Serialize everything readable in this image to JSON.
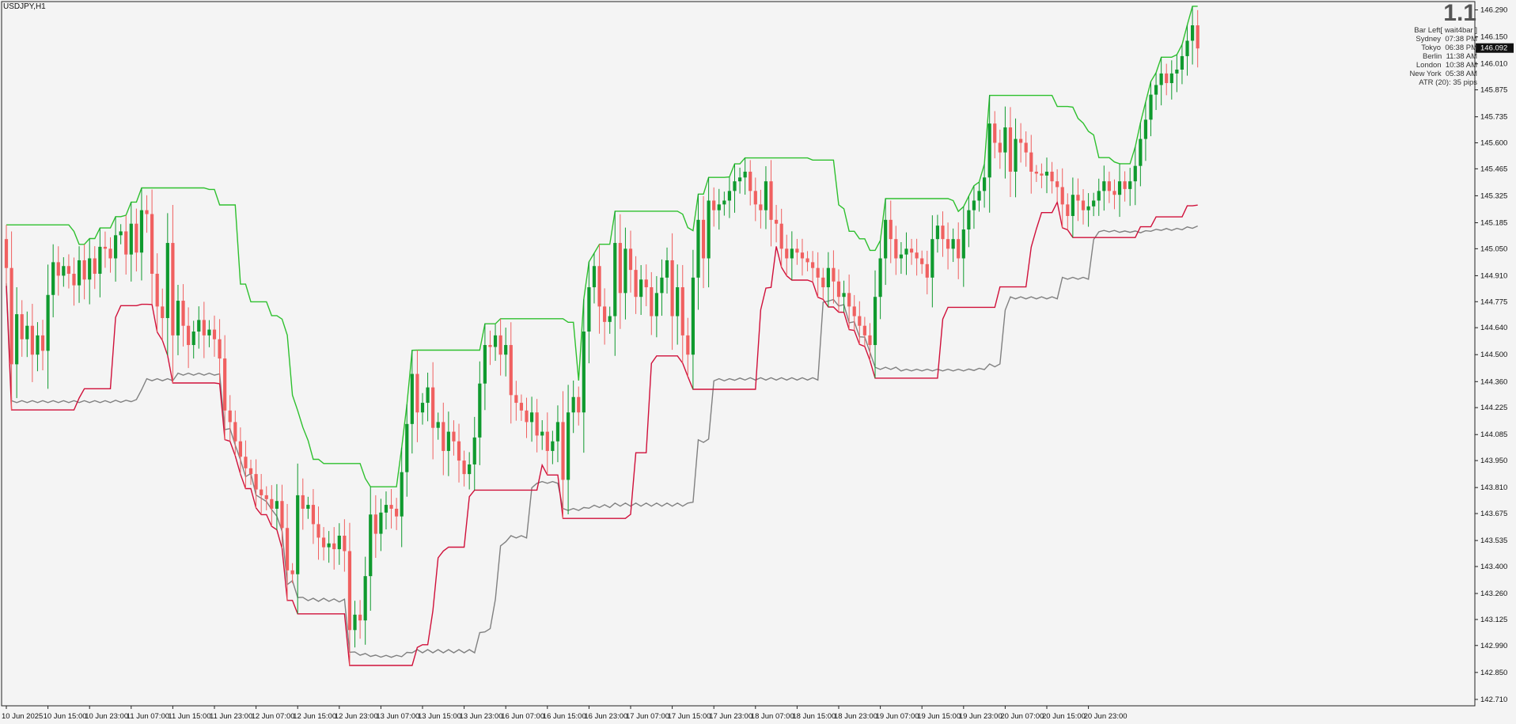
{
  "header": {
    "symbol": "USDJPY,H1",
    "version_label": "1.1"
  },
  "info_panel": {
    "bar_left": "Bar Left[ wait4bar ]",
    "rows": [
      {
        "city": "Sydney",
        "time": "07:38 PM"
      },
      {
        "city": "Tokyo",
        "time": "06:38 PM"
      },
      {
        "city": "Berlin",
        "time": "11:38 AM"
      },
      {
        "city": "London",
        "time": "10:38 AM"
      },
      {
        "city": "New York",
        "time": "05:38 AM"
      }
    ],
    "atr": "ATR (20): 35 pips"
  },
  "colors": {
    "background": "#f4f4f4",
    "bull": "#0f9a2e",
    "bear": "#f06060",
    "upper_line": "#2ec02e",
    "lower_line": "#d0103a",
    "mid_line": "#808080"
  },
  "chart_data": {
    "type": "candlestick",
    "price_labels": [
      "146.290",
      "146.150",
      "146.010",
      "145.875",
      "145.735",
      "145.600",
      "145.465",
      "145.325",
      "145.185",
      "145.050",
      "144.910",
      "144.775",
      "144.640",
      "144.500",
      "144.360",
      "144.225",
      "144.085",
      "143.950",
      "143.810",
      "143.675",
      "143.535",
      "143.400",
      "143.260",
      "143.125",
      "142.990",
      "142.850",
      "142.710"
    ],
    "current_price": "146.092",
    "ylim": [
      142.685,
      146.325
    ],
    "x_labels": [
      "10 Jun 2025",
      "10 Jun 15:00",
      "10 Jun 23:00",
      "11 Jun 07:00",
      "11 Jun 15:00",
      "11 Jun 23:00",
      "12 Jun 07:00",
      "12 Jun 15:00",
      "12 Jun 23:00",
      "13 Jun 07:00",
      "13 Jun 15:00",
      "13 Jun 23:00",
      "16 Jun 07:00",
      "16 Jun 15:00",
      "16 Jun 23:00",
      "17 Jun 07:00",
      "17 Jun 15:00",
      "17 Jun 23:00",
      "18 Jun 07:00",
      "18 Jun 15:00",
      "18 Jun 23:00",
      "19 Jun 07:00",
      "19 Jun 15:00",
      "19 Jun 23:00",
      "20 Jun 07:00",
      "20 Jun 15:00",
      "20 Jun 23:00"
    ],
    "x_label_bar_index": [
      0,
      8,
      16,
      24,
      32,
      40,
      48,
      56,
      64,
      72,
      80,
      88,
      96,
      104,
      112,
      120,
      128,
      136,
      144,
      152,
      160,
      168,
      176,
      184,
      192,
      200,
      208
    ],
    "closes": [
      144.95,
      144.45,
      144.71,
      144.58,
      144.65,
      144.5,
      144.6,
      144.52,
      144.81,
      144.98,
      144.91,
      144.96,
      144.92,
      144.86,
      144.99,
      144.89,
      145.0,
      144.92,
      145.06,
      145.05,
      145.0,
      145.12,
      145.14,
      145.02,
      145.18,
      145.03,
      145.25,
      145.23,
      144.92,
      144.75,
      144.69,
      145.08,
      144.6,
      144.78,
      144.65,
      144.55,
      144.62,
      144.68,
      144.6,
      144.63,
      144.58,
      144.48,
      144.21,
      144.15,
      144.05,
      143.97,
      143.91,
      143.88,
      143.8,
      143.77,
      143.75,
      143.7,
      143.74,
      143.6,
      143.38,
      143.36,
      143.77,
      143.7,
      143.72,
      143.62,
      143.55,
      143.5,
      143.52,
      143.49,
      143.56,
      143.48,
      143.07,
      143.15,
      143.12,
      143.35,
      143.67,
      143.57,
      143.68,
      143.72,
      143.7,
      143.66,
      143.89,
      144.14,
      144.4,
      144.2,
      144.25,
      144.33,
      144.12,
      144.15,
      144.0,
      144.1,
      144.05,
      143.95,
      143.88,
      143.93,
      144.07,
      144.35,
      144.55,
      144.54,
      144.6,
      144.5,
      144.55,
      144.29,
      144.25,
      144.21,
      144.15,
      144.2,
      144.08,
      144.1,
      144.0,
      144.05,
      144.15,
      143.85,
      144.2,
      144.28,
      144.2,
      144.62,
      144.85,
      144.96,
      144.75,
      144.67,
      144.7,
      145.08,
      144.82,
      145.05,
      144.94,
      144.8,
      144.89,
      144.85,
      144.7,
      144.82,
      144.9,
      144.99,
      144.7,
      144.85,
      144.6,
      144.5,
      144.9,
      145.2,
      145.0,
      145.3,
      145.25,
      145.28,
      145.3,
      145.35,
      145.4,
      145.42,
      145.45,
      145.35,
      145.28,
      145.25,
      145.4,
      145.2,
      145.18,
      145.05,
      145.0,
      145.05,
      145.03,
      145.0,
      144.98,
      144.95,
      144.9,
      144.85,
      144.95,
      144.88,
      144.8,
      144.82,
      144.75,
      144.7,
      144.65,
      144.6,
      144.55,
      144.8,
      145.0,
      145.2,
      145.1,
      145.0,
      145.02,
      145.05,
      145.03,
      145.0,
      144.97,
      144.9,
      145.1,
      145.17,
      145.1,
      145.05,
      145.1,
      145.0,
      145.15,
      145.25,
      145.3,
      145.35,
      145.42,
      145.7,
      145.6,
      145.55,
      145.68,
      145.45,
      145.62,
      145.6,
      145.55,
      145.45,
      145.44,
      145.43,
      145.45,
      145.4,
      145.37,
      145.28,
      145.22,
      145.33,
      145.3,
      145.25,
      145.27,
      145.3,
      145.35,
      145.4,
      145.35,
      145.33,
      145.4,
      145.36,
      145.4,
      145.48,
      145.62,
      145.72,
      145.85,
      145.9,
      145.96,
      145.91,
      145.96,
      145.98,
      146.05,
      146.13,
      146.21,
      146.09
    ]
  }
}
